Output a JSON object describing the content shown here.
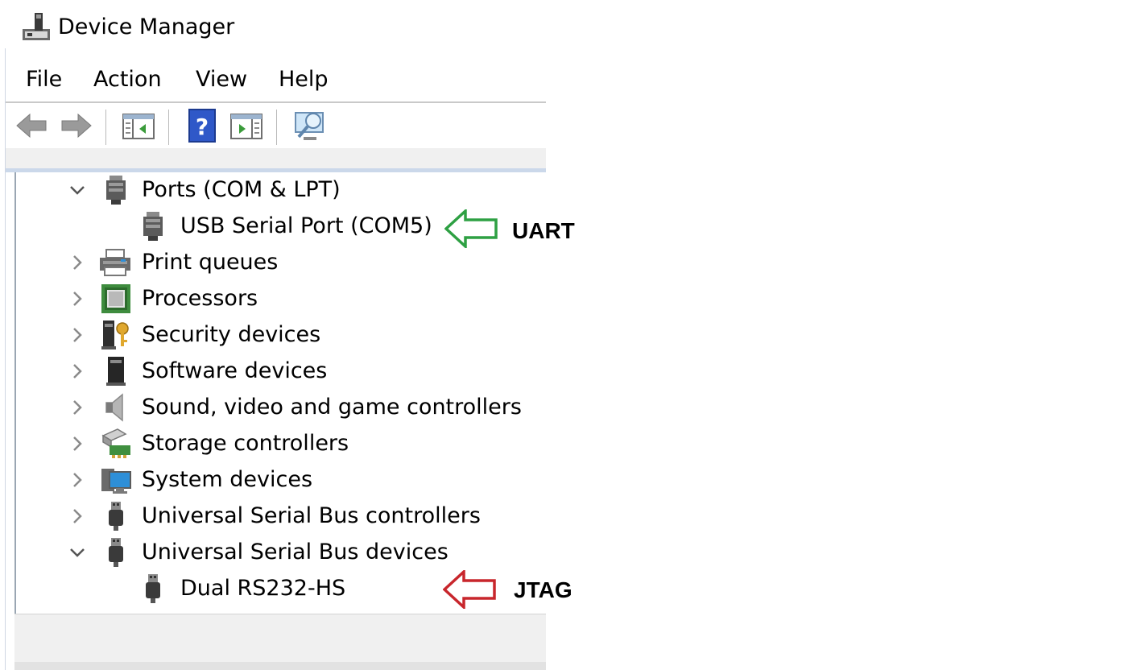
{
  "window": {
    "title": "Device Manager"
  },
  "menu": [
    "File",
    "Action",
    "View",
    "Help"
  ],
  "toolbar": {
    "buttons": [
      "back-arrow-icon",
      "forward-arrow-icon",
      "show-hide-console-tree-icon",
      "help-icon",
      "action-pane-icon",
      "scan-hardware-icon"
    ]
  },
  "tree": {
    "ports": "Ports (COM & LPT)",
    "usb_serial_port": "USB Serial Port (COM5)",
    "print_queues": "Print queues",
    "processors": "Processors",
    "security_devices": "Security devices",
    "software_devices": "Software devices",
    "sound": "Sound, video and game controllers",
    "storage": "Storage controllers",
    "system": "System devices",
    "usb_controllers": "Universal Serial Bus controllers",
    "usb_devices": "Universal Serial Bus devices",
    "dual_rs232": "Dual RS232-HS"
  },
  "annotations": {
    "uart": "UART",
    "jtag": "JTAG",
    "uart_color": "#2ea043",
    "jtag_color": "#c8262c"
  }
}
